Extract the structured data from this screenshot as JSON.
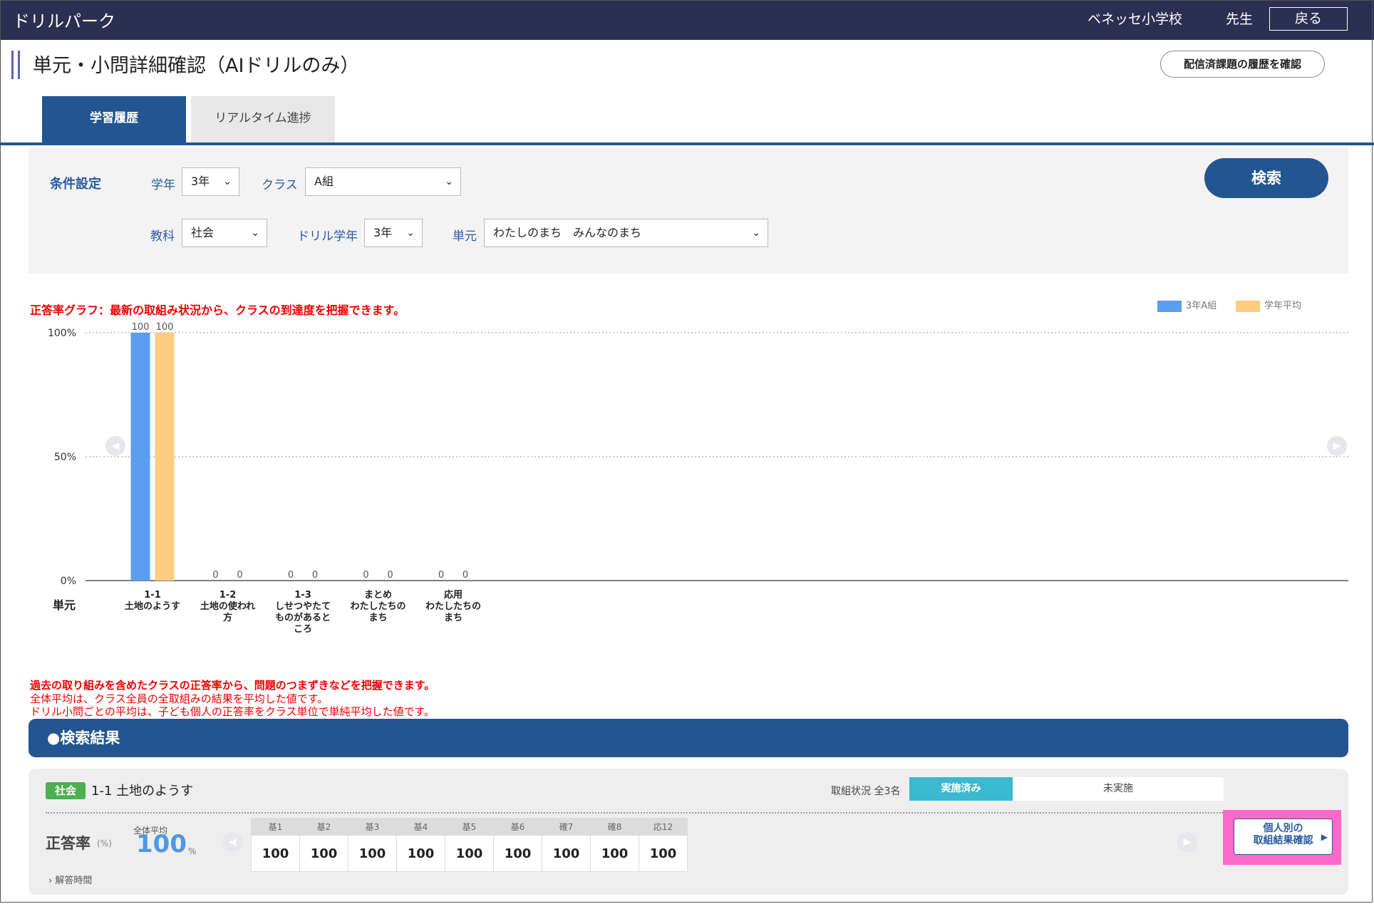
{
  "header": {
    "app_title": "ドリルパーク",
    "school": "ベネッセ小学校",
    "teacher": "先生",
    "back": "戻る"
  },
  "page": {
    "title": "単元・小問詳細確認（AIドリルのみ）",
    "history_button": "配信済課題の履歴を確認"
  },
  "tabs": [
    {
      "label": "学習履歴",
      "active": true
    },
    {
      "label": "リアルタイム進捗",
      "active": false
    }
  ],
  "filters": {
    "section_label": "条件設定",
    "grade_label": "学年",
    "grade_value": "3年",
    "class_label": "クラス",
    "class_value": "A組",
    "subject_label": "教科",
    "subject_value": "社会",
    "drill_grade_label": "ドリル学年",
    "drill_grade_value": "3年",
    "unit_label": "単元",
    "unit_value": "わたしのまち　みんなのまち",
    "search_button": "検索"
  },
  "chart_note": "正答率グラフ：最新の取組み状況から、クラスの到達度を把握できます。",
  "chart_data": {
    "type": "bar",
    "categories": [
      "1-1\n土地のようす",
      "1-2\n土地の使われ\n方",
      "1-3\nしせつやたて\nものがあると\nころ",
      "まとめ\nわたしたちの\nまち",
      "応用\nわたしたちの\nまち"
    ],
    "series": [
      {
        "name": "3年A組",
        "values": [
          100,
          0,
          0,
          0,
          0
        ],
        "color": "#5a9ef0"
      },
      {
        "name": "学年平均",
        "values": [
          100,
          0,
          0,
          0,
          0
        ],
        "color": "#ffcc80"
      }
    ],
    "yticks": [
      "100%",
      "50%",
      "0%"
    ],
    "ylim": [
      0,
      100
    ],
    "xlabel": "単元",
    "legend_position": "top-right",
    "grid": "dotted"
  },
  "notes": {
    "line1": "過去の取り組みを含めたクラスの正答率から、問題のつまずきなどを把握できます。",
    "line2": "全体平均は、クラス全員の全取組みの結果を平均した値です。",
    "line3": "ドリル小問ごとの平均は、子ども個人の正答率をクラス単位で単純平均した値です。"
  },
  "results": {
    "header": "●検索結果",
    "subject": "社会",
    "unit": "1-1 土地のようす",
    "status_label": "取組状況 全3名",
    "status_done": "実施済み",
    "status_not_done": "未実施",
    "accuracy_label": "正答率",
    "accuracy_unit": "(%)",
    "average_label": "全体平均",
    "average_value": "100",
    "average_pct": "%",
    "time_link": "解答時間",
    "subquestions": [
      {
        "label": "基1",
        "value": "100"
      },
      {
        "label": "基2",
        "value": "100"
      },
      {
        "label": "基3",
        "value": "100"
      },
      {
        "label": "基4",
        "value": "100"
      },
      {
        "label": "基5",
        "value": "100"
      },
      {
        "label": "基6",
        "value": "100"
      },
      {
        "label": "確7",
        "value": "100"
      },
      {
        "label": "確8",
        "value": "100"
      },
      {
        "label": "応12",
        "value": "100"
      }
    ],
    "individual_button_line1": "個人別の",
    "individual_button_line2": "取組結果確認"
  }
}
